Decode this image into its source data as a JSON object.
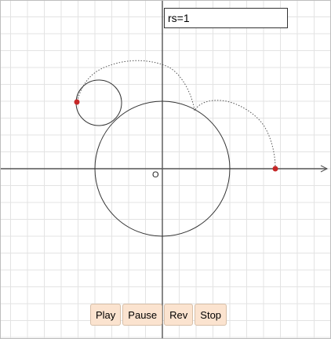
{
  "rs_field": {
    "value": "rs=1"
  },
  "origin_label": "O",
  "controls": [
    {
      "label": "Play"
    },
    {
      "label": "Pause"
    },
    {
      "label": "Rev"
    },
    {
      "label": "Stop"
    }
  ],
  "colors": {
    "grid": "#e3e3e3",
    "axis": "#555555",
    "curve": "#333333",
    "trace": "#555555",
    "point": "#c62828",
    "button_bg": "#fbe3cf"
  }
}
